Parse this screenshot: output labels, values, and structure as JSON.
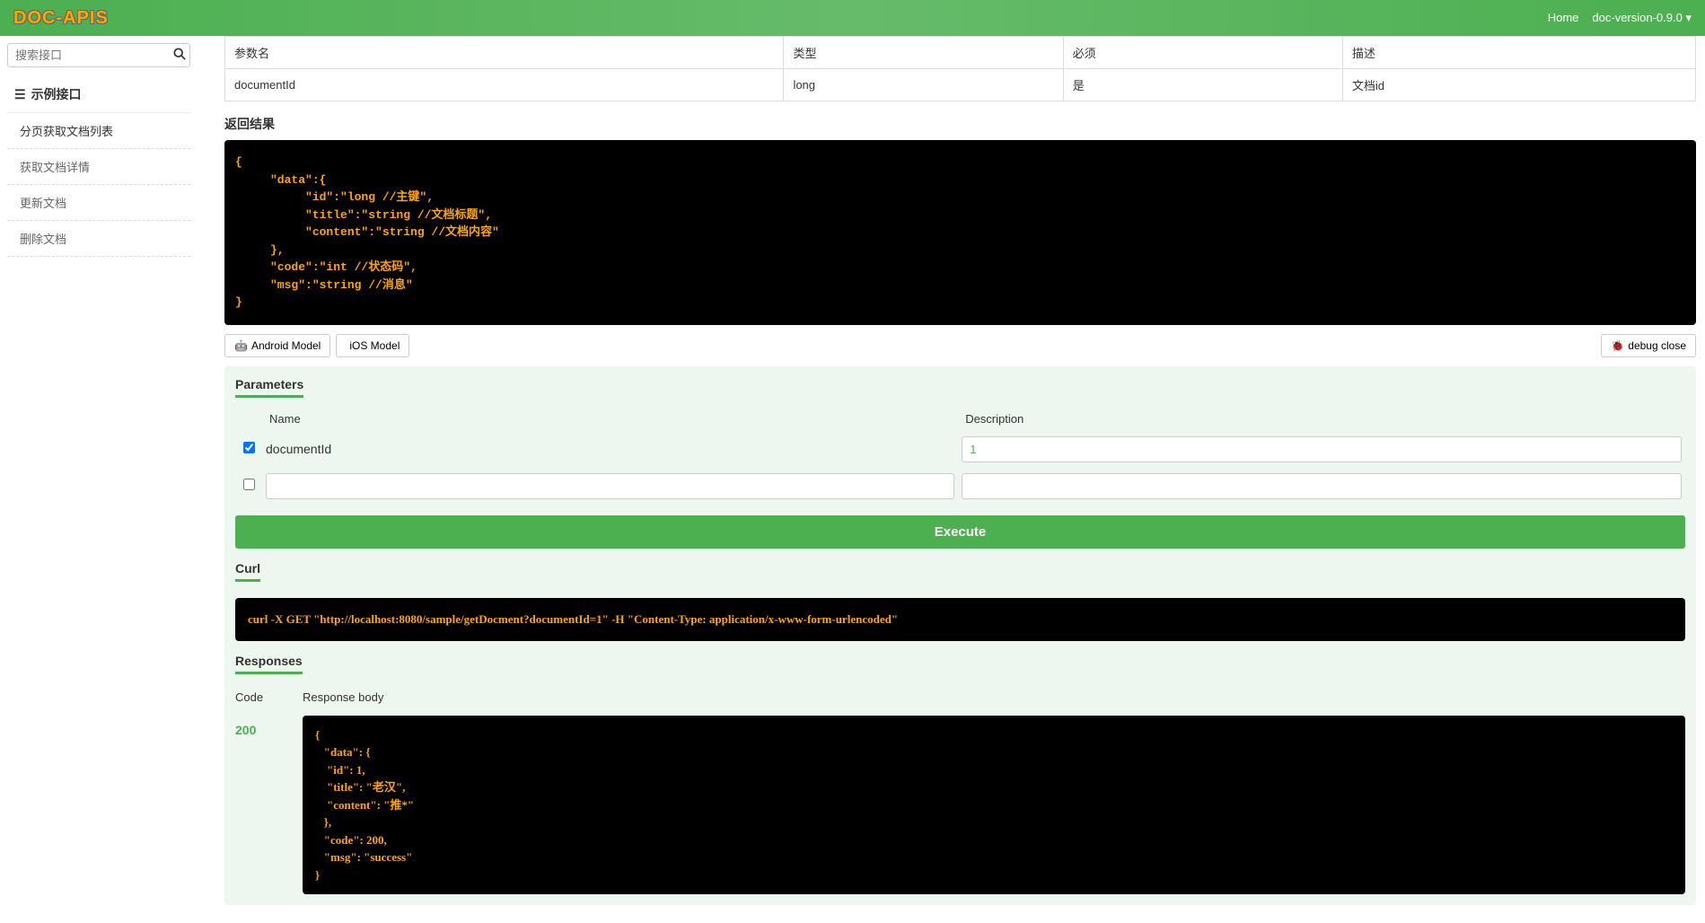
{
  "header": {
    "logo": "DOC-APIS",
    "home": "Home",
    "version": "doc-version-0.9.0"
  },
  "sidebar": {
    "search_placeholder": "搜索接口",
    "nav_title": "示例接口",
    "items": [
      {
        "label": "分页获取文档列表"
      },
      {
        "label": "获取文档详情"
      },
      {
        "label": "更新文档"
      },
      {
        "label": "删除文档"
      }
    ]
  },
  "paramTable": {
    "headers": [
      "参数名",
      "类型",
      "必须",
      "描述"
    ],
    "rows": [
      {
        "name": "documentId",
        "type": "long",
        "required": "是",
        "desc": "文档id"
      }
    ]
  },
  "returnLabel": "返回结果",
  "returnCode": "{\n     \"data\":{\n          \"id\":\"long //主键\",\n          \"title\":\"string //文档标题\",\n          \"content\":\"string //文档内容\"\n     },\n     \"code\":\"int //状态码\",\n     \"msg\":\"string //消息\"\n}",
  "buttons": {
    "android": "Android Model",
    "ios": "iOS Model",
    "debug_close": "debug close",
    "execute": "Execute"
  },
  "debug": {
    "parameters_title": "Parameters",
    "name_header": "Name",
    "desc_header": "Description",
    "rows": [
      {
        "checked": true,
        "name": "documentId",
        "value": "1"
      },
      {
        "checked": false,
        "name": "",
        "value": ""
      }
    ],
    "curl_title": "Curl",
    "curl_cmd": "curl -X GET \"http://localhost:8080/sample/getDocment?documentId=1\" -H \"Content-Type: application/x-www-form-urlencoded\"",
    "responses_title": "Responses",
    "code_header": "Code",
    "body_header": "Response body",
    "response_code": "200",
    "response_body": "{\n   \"data\": {\n    \"id\": 1,\n    \"title\": \"老汉\",\n    \"content\": \"推*\"\n   },\n   \"code\": 200,\n   \"msg\": \"success\"\n}"
  }
}
